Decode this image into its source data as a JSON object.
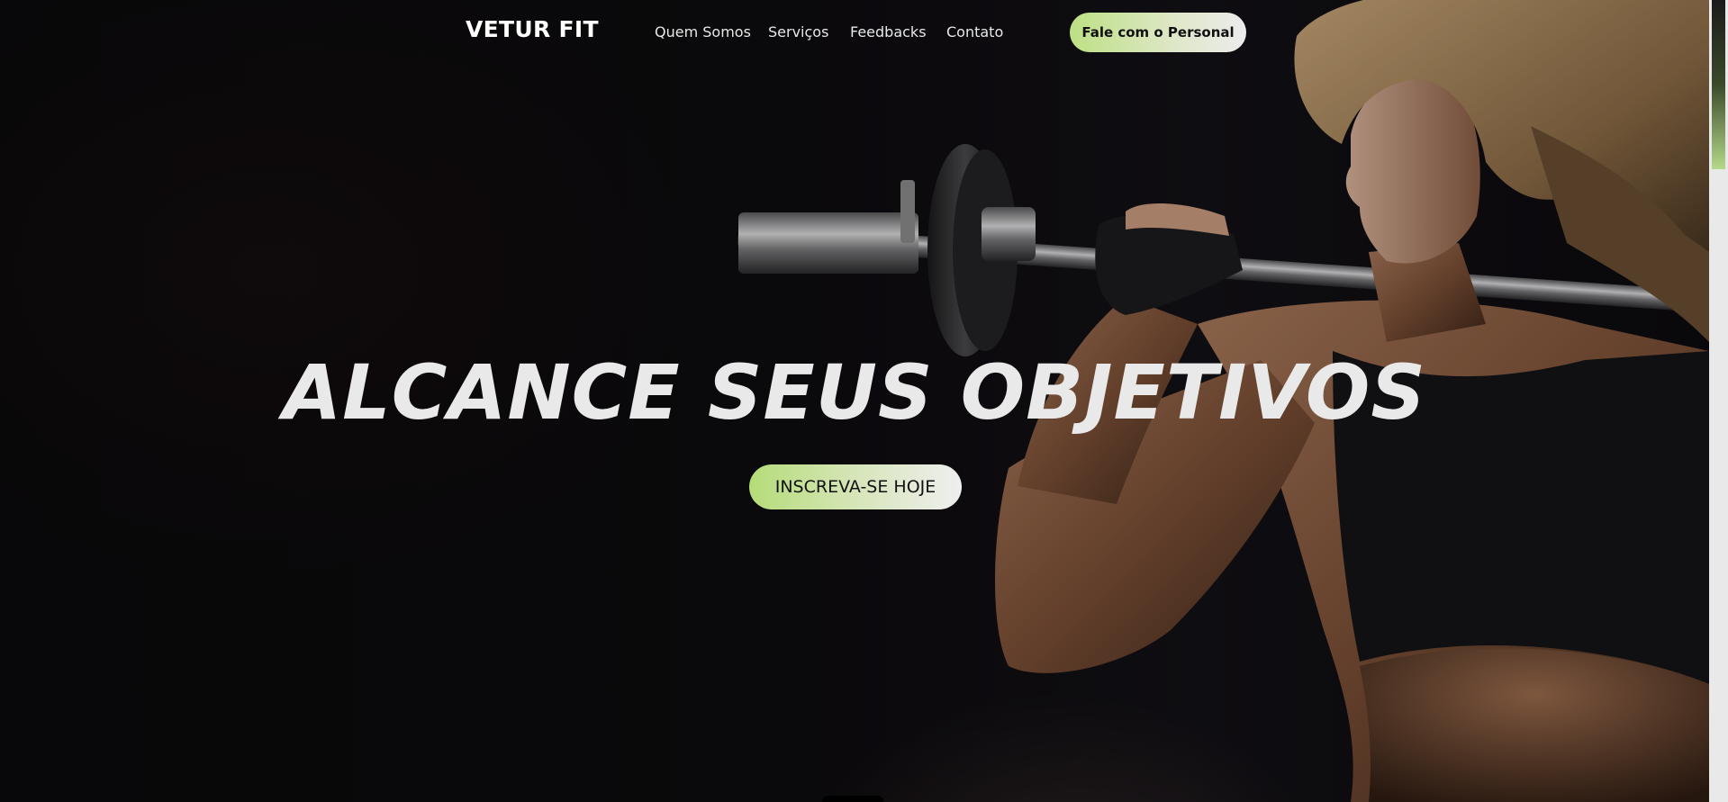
{
  "header": {
    "logo": "VETUR FIT",
    "nav": [
      {
        "label": "Quem Somos"
      },
      {
        "label": "Serviços"
      },
      {
        "label": "Feedbacks"
      },
      {
        "label": "Contato"
      }
    ],
    "cta_label": "Fale com o Personal"
  },
  "hero": {
    "title": "ALCANCE SEUS OBJETIVOS",
    "cta_label": "INSCREVA-SE HOJE",
    "image": "woman-with-barbell-photo"
  },
  "colors": {
    "background": "#0b0a0c",
    "accent_green": "#b5dc78",
    "text": "#e9e9e9"
  }
}
